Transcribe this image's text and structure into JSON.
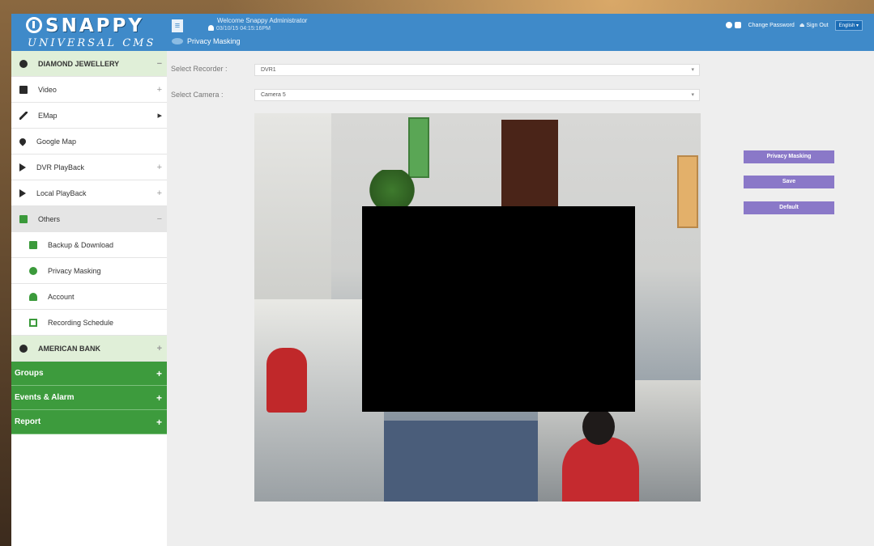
{
  "logo": {
    "main": "SNAPPY",
    "sub": "UNIVERSAL CMS"
  },
  "header": {
    "welcome": "Welcome Snappy Administrator",
    "datetime": "03/10/15 04:15:16PM",
    "page": "Privacy Masking",
    "change_password": "Change Password",
    "sign_out": "Sign Out",
    "language": "English"
  },
  "sidebar": {
    "group1": {
      "label": "DIAMOND JEWELLERY",
      "sign": "−"
    },
    "items": [
      {
        "label": "Video",
        "sign": "+"
      },
      {
        "label": "EMap",
        "sign": "▸"
      },
      {
        "label": "Google Map",
        "sign": ""
      },
      {
        "label": "DVR PlayBack",
        "sign": "+"
      },
      {
        "label": "Local PlayBack",
        "sign": "+"
      },
      {
        "label": "Others",
        "sign": "−"
      }
    ],
    "others": [
      {
        "label": "Backup & Download"
      },
      {
        "label": "Privacy Masking"
      },
      {
        "label": "Account"
      },
      {
        "label": "Recording Schedule"
      }
    ],
    "group2": {
      "label": "AMERICAN BANK",
      "sign": "+"
    },
    "bars": [
      {
        "label": "Groups",
        "sign": "+"
      },
      {
        "label": "Events & Alarm",
        "sign": "+"
      },
      {
        "label": "Report",
        "sign": "+"
      }
    ]
  },
  "form": {
    "recorder_label": "Select Recorder :",
    "recorder_value": "DVR1",
    "camera_label": "Select Camera :",
    "camera_value": "Camera 5"
  },
  "actions": {
    "privacy_masking": "Privacy Masking",
    "save": "Save",
    "default": "Default"
  },
  "colors": {
    "header": "#3f8ac9",
    "sidebar_green": "#3d9b3d",
    "button_purple": "#8a78c8",
    "mask": "#000000"
  }
}
